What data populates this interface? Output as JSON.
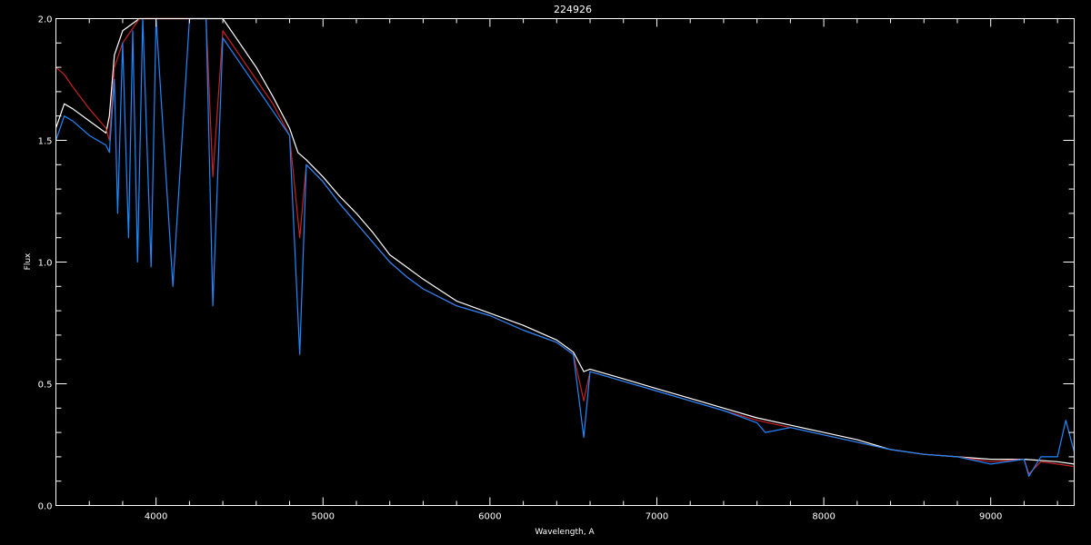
{
  "chart_data": {
    "type": "line",
    "title": "224926",
    "xlabel": "Wavelength, A",
    "ylabel": "Flux",
    "xlim": [
      3400,
      9500
    ],
    "ylim": [
      0.0,
      2.0
    ],
    "x_ticks": [
      4000,
      5000,
      6000,
      7000,
      8000,
      9000
    ],
    "y_ticks": [
      0.0,
      0.5,
      1.0,
      1.5,
      2.0
    ],
    "y_tick_labels": [
      "0.0",
      "0.5",
      "1.0",
      "1.5",
      "2.0"
    ],
    "grid": false,
    "background": "#000000",
    "series": [
      {
        "color": "#ffffff",
        "x": [
          3400,
          3450,
          3500,
          3600,
          3700,
          3720,
          3750,
          3800,
          3900,
          4000,
          4100,
          4200,
          4300,
          4400,
          4500,
          4600,
          4700,
          4800,
          4850,
          4900,
          5000,
          5100,
          5200,
          5300,
          5400,
          5500,
          5600,
          5800,
          6000,
          6200,
          6400,
          6500,
          6562,
          6600,
          6800,
          7000,
          7200,
          7400,
          7600,
          7800,
          8000,
          8200,
          8400,
          8600,
          8800,
          9000,
          9200,
          9400,
          9500
        ],
        "y": [
          1.55,
          1.65,
          1.63,
          1.58,
          1.53,
          1.6,
          1.85,
          1.95,
          2.05,
          2.1,
          2.15,
          2.1,
          2.05,
          2.0,
          1.9,
          1.8,
          1.68,
          1.55,
          1.45,
          1.42,
          1.35,
          1.27,
          1.2,
          1.12,
          1.03,
          0.98,
          0.93,
          0.84,
          0.79,
          0.74,
          0.68,
          0.63,
          0.55,
          0.56,
          0.52,
          0.48,
          0.44,
          0.4,
          0.36,
          0.33,
          0.3,
          0.27,
          0.23,
          0.21,
          0.2,
          0.19,
          0.19,
          0.18,
          0.17
        ]
      },
      {
        "color": "#cc2222",
        "x": [
          3400,
          3450,
          3500,
          3600,
          3700,
          3720,
          3750,
          3800,
          3900,
          4000,
          4100,
          4200,
          4300,
          4340,
          4400,
          4500,
          4600,
          4700,
          4800,
          4861,
          4900,
          5000,
          5100,
          5200,
          5300,
          5400,
          5500,
          5600,
          5800,
          6000,
          6200,
          6400,
          6500,
          6562,
          6600,
          6800,
          7000,
          7200,
          7400,
          7600,
          7800,
          8000,
          8200,
          8400,
          8600,
          8800,
          9000,
          9200,
          9229,
          9300,
          9400,
          9500
        ],
        "y": [
          1.8,
          1.77,
          1.72,
          1.63,
          1.55,
          1.5,
          1.8,
          1.9,
          2.0,
          2.05,
          2.1,
          2.05,
          2.0,
          1.35,
          1.95,
          1.85,
          1.75,
          1.65,
          1.52,
          1.1,
          1.4,
          1.33,
          1.24,
          1.16,
          1.08,
          1.0,
          0.94,
          0.89,
          0.82,
          0.78,
          0.72,
          0.67,
          0.62,
          0.43,
          0.55,
          0.51,
          0.47,
          0.43,
          0.39,
          0.35,
          0.32,
          0.29,
          0.26,
          0.23,
          0.21,
          0.2,
          0.18,
          0.19,
          0.13,
          0.18,
          0.17,
          0.16
        ]
      },
      {
        "color": "#1e88ff",
        "x": [
          3400,
          3450,
          3500,
          3600,
          3700,
          3720,
          3750,
          3770,
          3800,
          3835,
          3860,
          3889,
          3920,
          3970,
          4000,
          4101,
          4200,
          4300,
          4340,
          4400,
          4500,
          4600,
          4700,
          4800,
          4861,
          4900,
          5000,
          5100,
          5200,
          5300,
          5400,
          5500,
          5600,
          5800,
          6000,
          6200,
          6400,
          6500,
          6562,
          6600,
          6800,
          7000,
          7200,
          7400,
          7600,
          7650,
          7800,
          8000,
          8200,
          8400,
          8600,
          8800,
          9000,
          9200,
          9229,
          9300,
          9400,
          9450,
          9500
        ],
        "y": [
          1.5,
          1.6,
          1.58,
          1.52,
          1.48,
          1.45,
          1.75,
          1.2,
          1.9,
          1.1,
          1.95,
          1.0,
          2.0,
          0.98,
          2.05,
          0.9,
          2.05,
          2.0,
          0.82,
          1.92,
          1.82,
          1.72,
          1.62,
          1.52,
          0.62,
          1.4,
          1.33,
          1.24,
          1.16,
          1.08,
          1.0,
          0.94,
          0.89,
          0.82,
          0.78,
          0.72,
          0.67,
          0.62,
          0.28,
          0.55,
          0.51,
          0.47,
          0.43,
          0.39,
          0.34,
          0.3,
          0.32,
          0.29,
          0.26,
          0.23,
          0.21,
          0.2,
          0.17,
          0.19,
          0.12,
          0.2,
          0.2,
          0.35,
          0.22
        ]
      }
    ]
  }
}
